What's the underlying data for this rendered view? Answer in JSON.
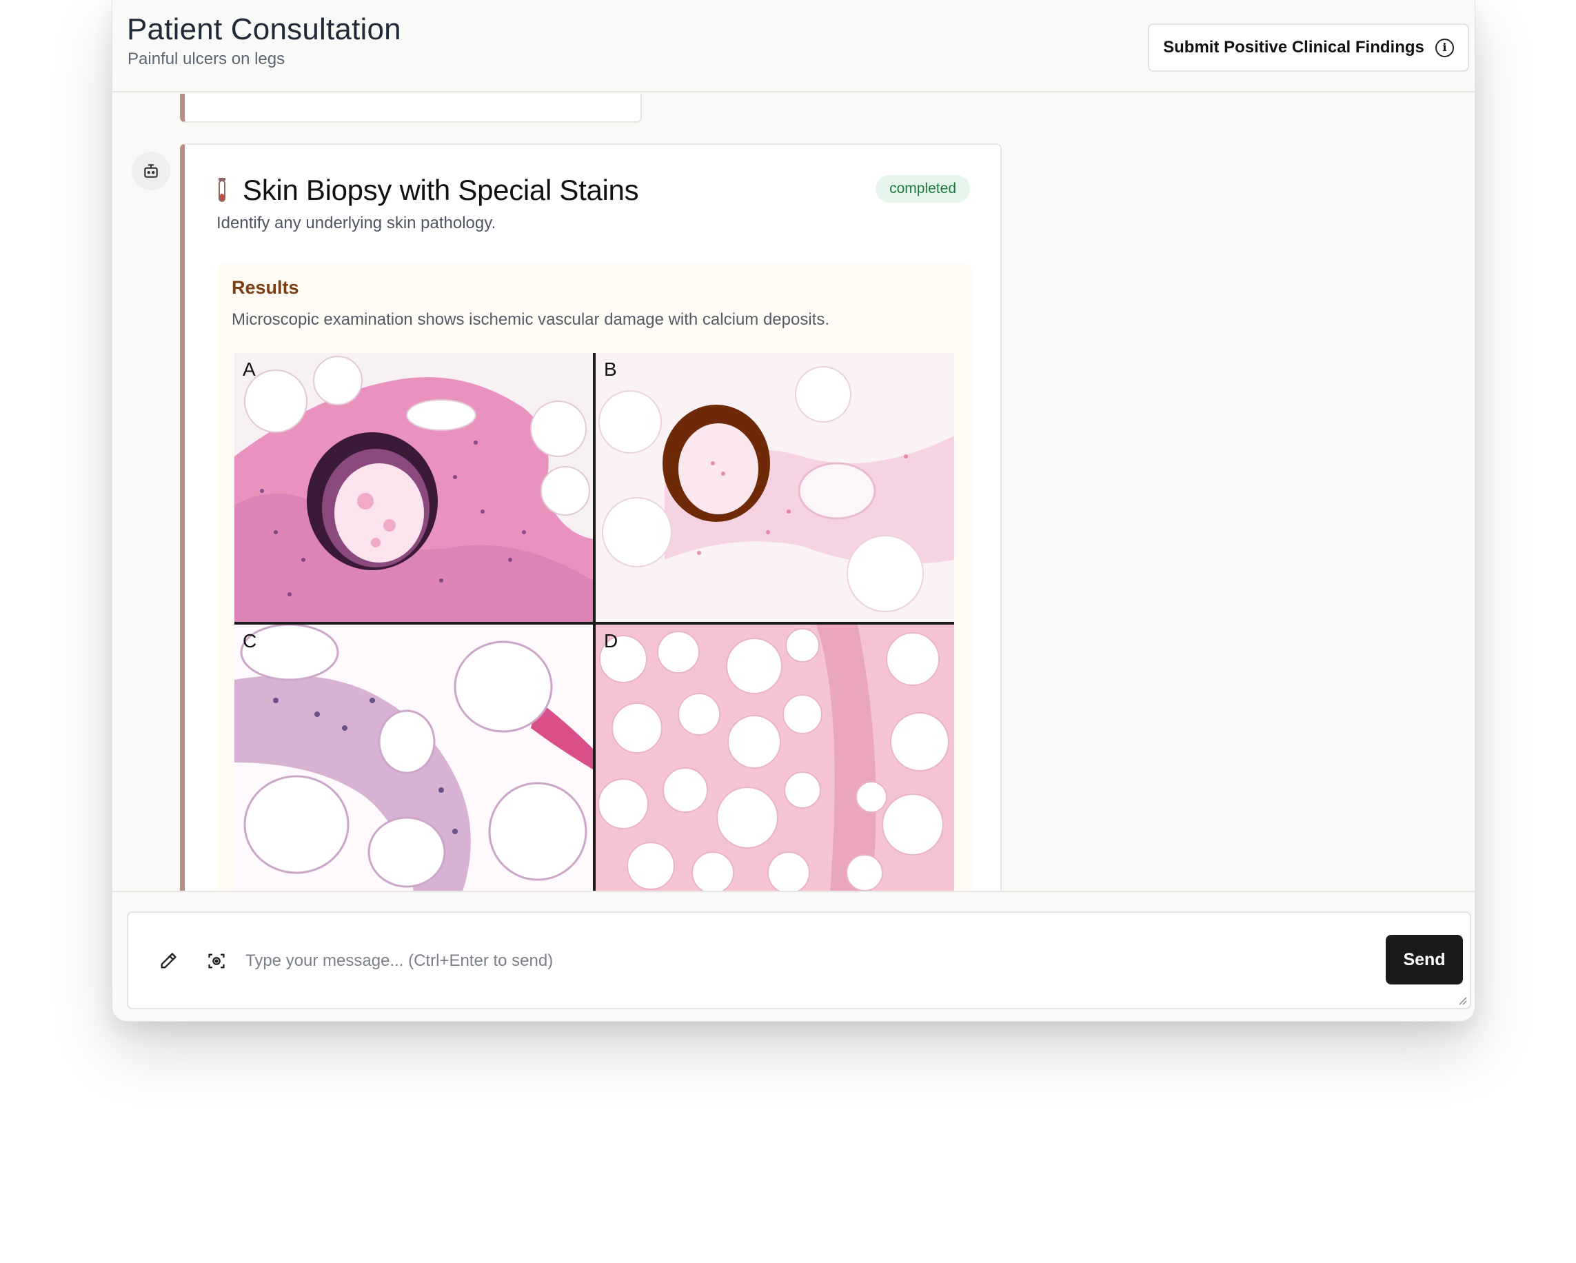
{
  "header": {
    "title": "Patient Consultation",
    "subtitle": "Painful ulcers on legs",
    "submit_label": "Submit Positive Clinical Findings",
    "info_glyph": "i"
  },
  "card": {
    "icon": "test-tube-icon",
    "title": "Skin Biopsy with Special Stains",
    "status": "completed",
    "description": "Identify any underlying skin pathology.",
    "results_heading": "Results",
    "results_text": "Microscopic examination shows ischemic vascular damage with calcium deposits.",
    "panels": [
      "A",
      "B",
      "C",
      "D"
    ]
  },
  "composer": {
    "placeholder": "Type your message... (Ctrl+Enter to send)",
    "send_label": "Send",
    "tools": [
      "pencil-icon",
      "camera-scan-icon"
    ]
  },
  "colors": {
    "accent_border": "#b88f85",
    "status_bg": "#e6f6ec",
    "status_text": "#1f7a3d",
    "results_heading": "#7a3e12",
    "send_bg": "#1a1a1a"
  }
}
